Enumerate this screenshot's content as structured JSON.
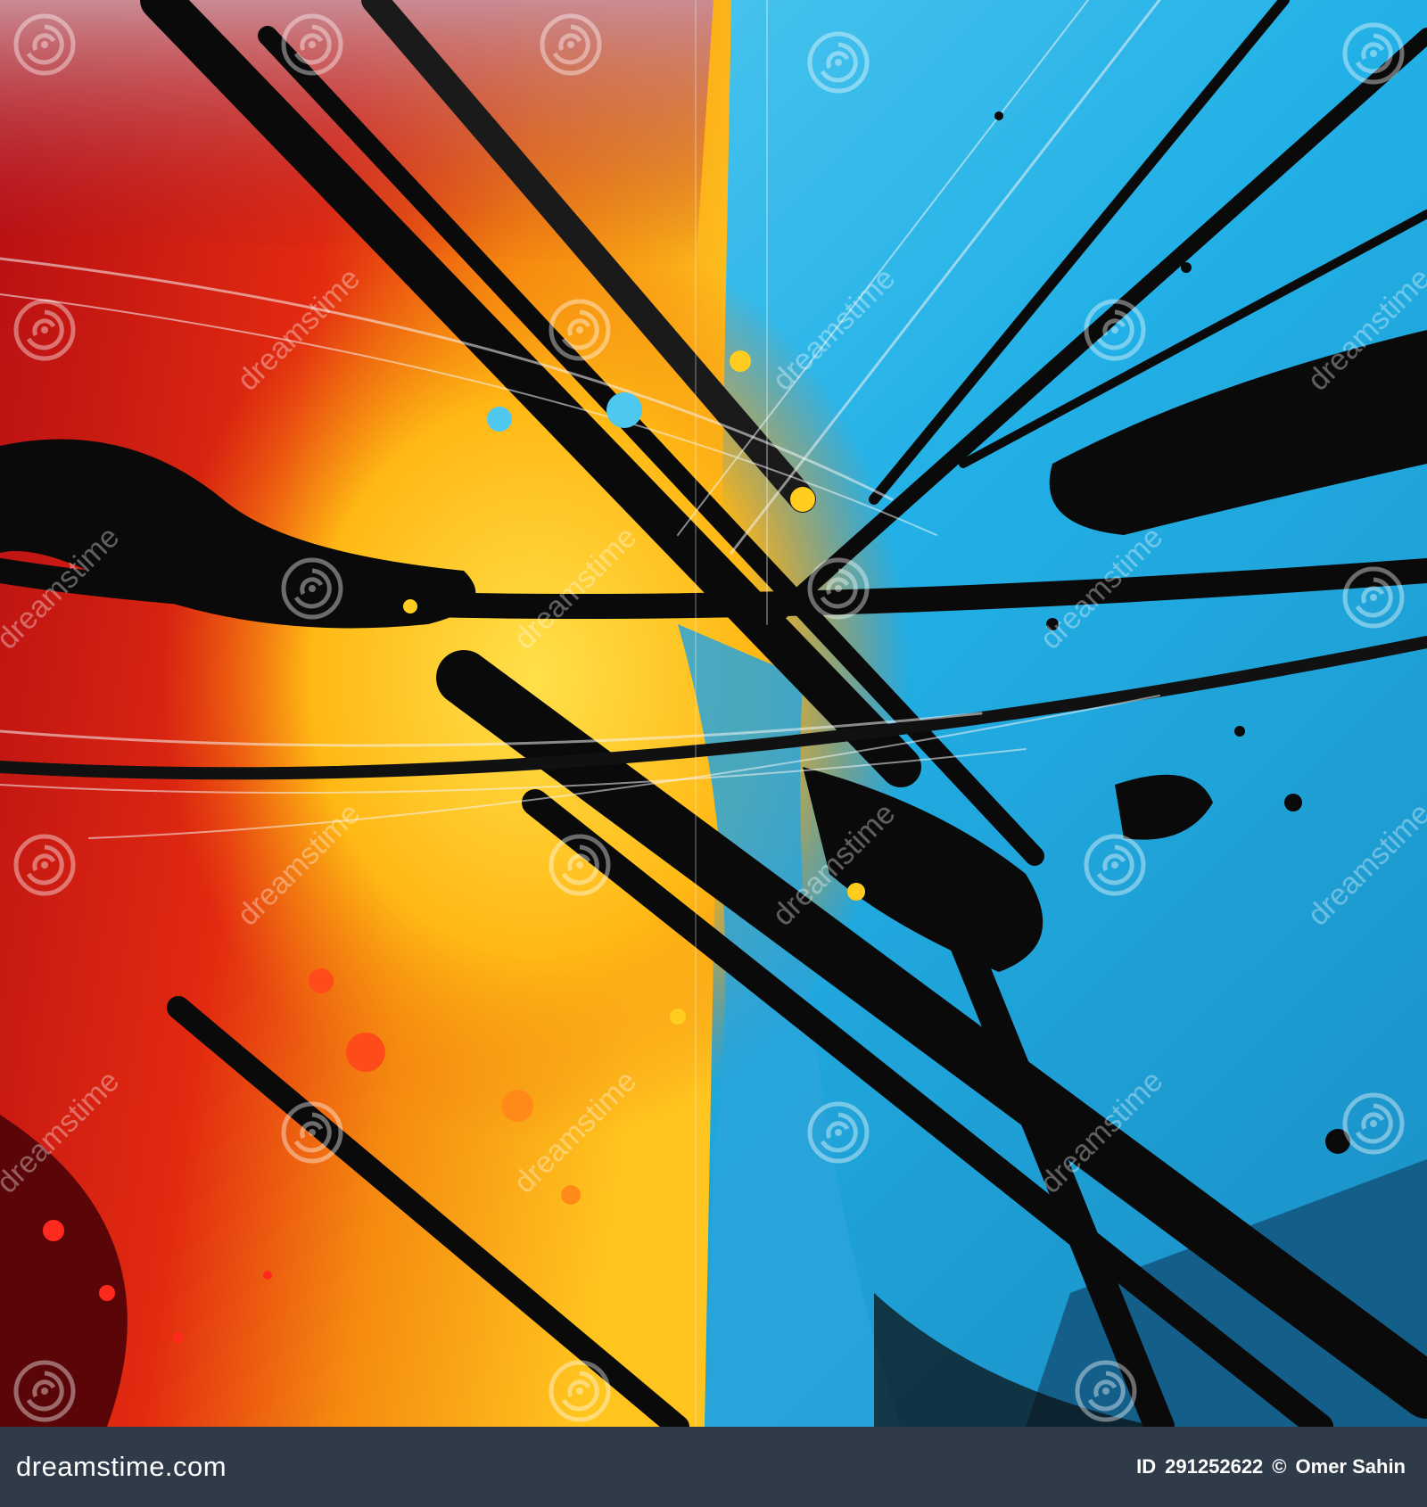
{
  "image": {
    "subject": "abstract painting",
    "palette": {
      "red": "#c8141a",
      "orange": "#f59a12",
      "yellow": "#ffcc1f",
      "cyan": "#2bb6e8",
      "light_blue": "#6fd2f2",
      "black": "#0a0a0a"
    }
  },
  "watermark": {
    "brand": "dreamstime",
    "icon": "spiral-logo-icon"
  },
  "footer": {
    "brand": "dreamstime.com",
    "id_label": "ID",
    "id_value": "291252622",
    "copyright_symbol": "©",
    "author": "Omer Sahin",
    "background": "#2f3b49"
  }
}
